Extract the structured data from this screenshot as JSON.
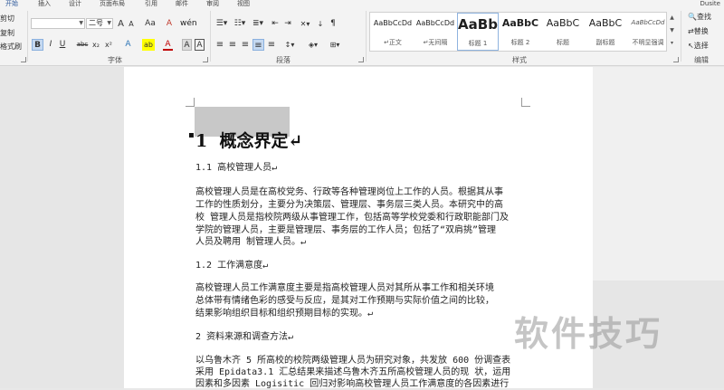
{
  "tabs": [
    "开始",
    "插入",
    "设计",
    "页面布局",
    "引用",
    "邮件",
    "审阅",
    "视图"
  ],
  "user": "Dusite",
  "clipboard": {
    "cut": "剪切",
    "copy": "复制",
    "painter": "格式刷"
  },
  "font": {
    "group_label": "字体",
    "size": "二号",
    "grow": "A",
    "shrink": "A",
    "case": "Aa",
    "clear": "A",
    "bold": "B",
    "italic": "I",
    "underline": "U",
    "strike": "abc",
    "sub": "x₂",
    "sup": "x²",
    "effects": "A",
    "highlight": "ab",
    "color": "A",
    "charbox": "A",
    "charshade": "A"
  },
  "paragraph": {
    "group_label": "段落"
  },
  "styles": {
    "group_label": "样式",
    "items": [
      {
        "preview": "AaBbCcDd",
        "name": "↵正文"
      },
      {
        "preview": "AaBbCcDd",
        "name": "↵无间隔"
      },
      {
        "preview": "AaBb",
        "name": "标题 1"
      },
      {
        "preview": "AaBbC",
        "name": "标题 2"
      },
      {
        "preview": "AaBbC",
        "name": "标题"
      },
      {
        "preview": "AaBbC",
        "name": "副标题"
      },
      {
        "preview": "AaBbCcDd",
        "name": "不明显强调"
      }
    ]
  },
  "editing": {
    "group_label": "编辑",
    "find": "查找",
    "replace": "替换",
    "select": "选择"
  },
  "document": {
    "heading_num": "1",
    "heading_text": "概念界定↵",
    "lines": [
      "1.1 高校管理人员↵",
      "高校管理人员是在高校党务、行政等各种管理岗位上工作的人员。根据其从事",
      "工作的性质划分，主要分为决策层、管理层、事务层三类人员。本研究中的高",
      "校 管理人员是指校院两级从事管理工作，包括高等学校党委和行政职能部门及",
      "学院的管理人员，主要是管理层、事务层的工作人员；包括了“双肩挑”管理",
      "人员及聘用 制管理人员。↵",
      "1.2 工作满意度↵",
      "高校管理人员工作满意度主要是指高校管理人员对其所从事工作和相关环境",
      "总体带有情绪色彩的感受与反应，是其对工作预期与实际价值之间的比较，",
      "结果影响组织目标和组织预期目标的实现。↵",
      "2 资料来源和调查方法↵",
      "以乌鲁木齐 5 所高校的校院两级管理人员为研究对象，共发放 600 份调查表",
      "采用 Epidata3.1 汇总结果来描述乌鲁木齐五所高校管理人员的现 状，运用",
      "因素和多因素 Logisitic 回归对影响高校管理人员工作满意度的各因素进行"
    ]
  },
  "watermark": "软件技巧"
}
